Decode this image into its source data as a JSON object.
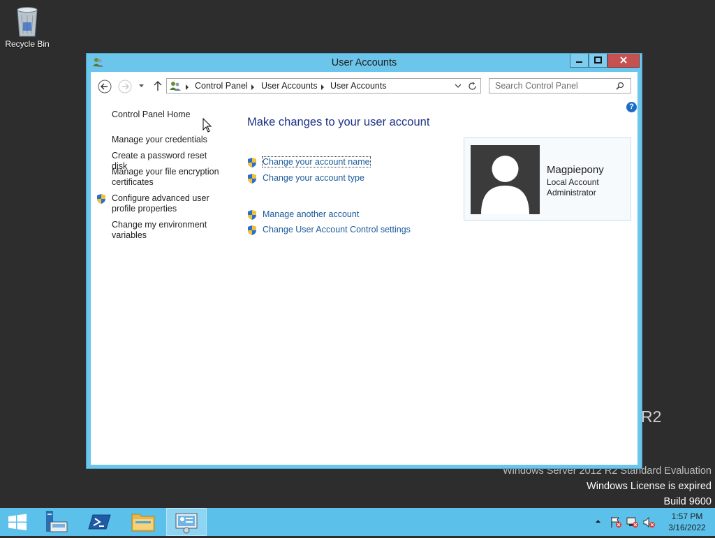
{
  "desktop": {
    "recycle_bin_label": "Recycle Bin",
    "watermark": {
      "line1": "Windows Server 2012 R2 Standard Evaluation",
      "line2": "Windows License is expired",
      "line3": "Build 9600"
    },
    "background_fragment": "R2"
  },
  "window": {
    "title": "User Accounts",
    "address": {
      "crumbs": [
        "Control Panel",
        "User Accounts",
        "User Accounts"
      ]
    },
    "search": {
      "placeholder": "Search Control Panel"
    },
    "left_pane": {
      "home": "Control Panel Home",
      "links": [
        "Manage your credentials",
        "Create a password reset disk",
        "Manage your file encryption certificates",
        "Configure advanced user profile properties",
        "Change my environment variables"
      ]
    },
    "main": {
      "heading": "Make changes to your user account",
      "tasks": [
        "Change your account name",
        "Change your account type",
        "Manage another account",
        "Change User Account Control settings"
      ]
    },
    "account": {
      "name": "Magpiepony",
      "type": "Local Account",
      "role": "Administrator"
    }
  },
  "taskbar": {
    "items": [
      "start-button",
      "server-manager",
      "powershell",
      "file-explorer",
      "control-panel"
    ],
    "active_item": "control-panel",
    "clock": {
      "time": "1:57 PM",
      "date": "3/16/2022"
    }
  },
  "colors": {
    "window_frame": "#6cc5ea",
    "taskbar": "#5cc1ea",
    "link": "#1a5a9b",
    "heading": "#1e3287",
    "close_button": "#c75050",
    "desktop": "#2d2d2d"
  }
}
